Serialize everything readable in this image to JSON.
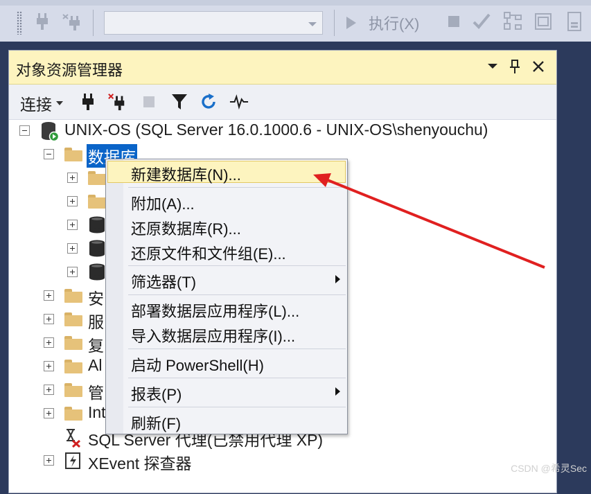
{
  "toolbar": {
    "execute_label": "执行(X)",
    "icons": [
      "connect-plug-icon",
      "disconnect-plug-icon",
      "execute-triangle-icon",
      "stop-icon",
      "check-icon",
      "plan-icon",
      "results-icon"
    ]
  },
  "panel": {
    "title": "对象资源管理器",
    "connect_label": "连接",
    "title_controls": [
      "dropdown-icon",
      "pin-icon",
      "close-icon"
    ]
  },
  "tree": {
    "server": "UNIX-OS (SQL Server 16.0.1000.6 - UNIX-OS\\shenyouchu)",
    "databases": "数据库",
    "items": [
      "安",
      "服",
      "复",
      "Al",
      "管",
      "Int"
    ],
    "agent": "SQL Server 代理(已禁用代理 XP)",
    "xevent": "XEvent 探查器"
  },
  "menu": {
    "items": [
      "新建数据库(N)...",
      "附加(A)...",
      "还原数据库(R)...",
      "还原文件和文件组(E)...",
      "筛选器(T)",
      "部署数据层应用程序(L)...",
      "导入数据层应用程序(I)...",
      "启动 PowerShell(H)",
      "报表(P)",
      "刷新(F)"
    ]
  },
  "watermark": "CSDN @希灵Sec",
  "colors": {
    "selection": "#0a64c8",
    "highlight": "#fdf4bf",
    "arrow": "#e02020",
    "folder": "#e6c27a"
  }
}
